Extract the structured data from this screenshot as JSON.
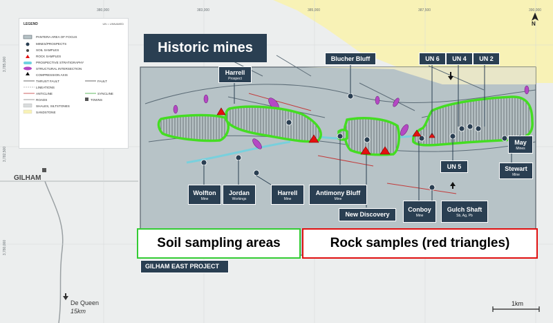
{
  "project_title": "GILHAM EAST PROJECT",
  "callouts": {
    "historic_mines": "Historic mines",
    "soil_sampling": "Soil sampling areas",
    "rock_samples": "Rock samples (red triangles)"
  },
  "legend": {
    "title": "LEGEND",
    "note": "UN = UNNAMED",
    "items": [
      "PANTERA AREA OF FOCUS",
      "MINES/PROSPECTS",
      "SOIL SAMPLES",
      "ROCK SAMPLES",
      "PROSPECTIVE STRATIGRAPHY",
      "STRUCTURAL INTERSECTION",
      "COMPRESSION AXIS",
      "THRUST FAULT",
      "FAULT",
      "LINEATIONS",
      "ANTICLINE",
      "SYNCLINE",
      "ROADS",
      "TOWNS",
      "SHALES, SILTSTONES",
      "SANDSTONE"
    ]
  },
  "mines": {
    "blucher_bluff": {
      "name": "Blucher Bluff"
    },
    "un6": {
      "name": "UN 6"
    },
    "un4": {
      "name": "UN 4"
    },
    "un2": {
      "name": "UN 2"
    },
    "harrell_prospect": {
      "name": "Harrell",
      "sub": "Prospect"
    },
    "may": {
      "name": "May",
      "sub": "Mines"
    },
    "un5": {
      "name": "UN 5"
    },
    "stewart": {
      "name": "Stewart",
      "sub": "Mine"
    },
    "wolfton": {
      "name": "Wolfton",
      "sub": "Mine"
    },
    "jordan": {
      "name": "Jordan",
      "sub": "Workings"
    },
    "harrell_mine": {
      "name": "Harrell",
      "sub": "Mine"
    },
    "antimony_bluff": {
      "name": "Antimony Bluff",
      "sub": "Mine"
    },
    "conboy": {
      "name": "Conboy",
      "sub": "Mine"
    },
    "gulch_shaft": {
      "name": "Gulch Shaft",
      "sub": "Sb, Ag, Pb"
    },
    "new_discovery": {
      "name": "New Discovery"
    }
  },
  "town": "GILHAM",
  "de_queen": {
    "name": "De Queen",
    "distance": "15km"
  },
  "north": "N",
  "scale": "1km",
  "eastings": [
    "380,000",
    "383,000",
    "385,000",
    "387,500",
    "390,000"
  ],
  "northings": [
    "3,785,000",
    "3,782,500",
    "3,780,000"
  ],
  "colors": {
    "focus_area": "#b7c3c7",
    "soil_outline": "#44dd22",
    "rock_triangle": "#e41010",
    "callout_green": "#33cc33",
    "callout_red": "#e01010",
    "label_bg": "#2a3f52",
    "sandstone": "#f8f2b6"
  }
}
